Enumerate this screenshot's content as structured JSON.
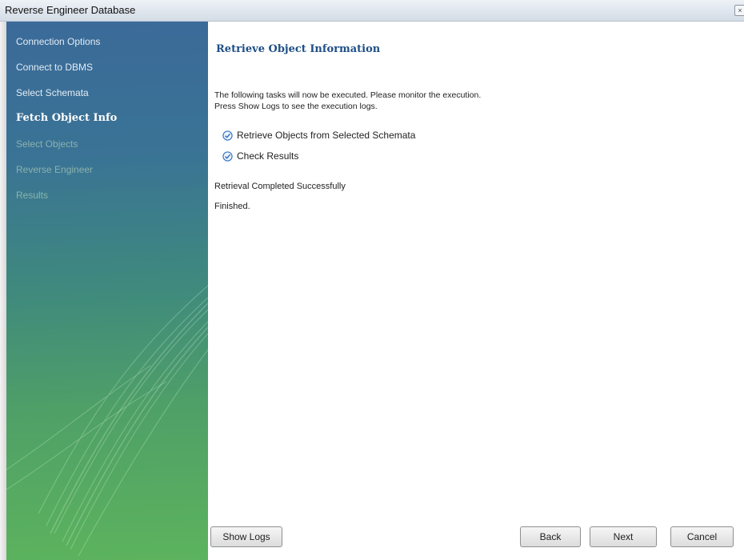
{
  "window": {
    "title": "Reverse Engineer Database"
  },
  "sidebar": {
    "steps": [
      {
        "label": "Connection Options",
        "state": "done"
      },
      {
        "label": "Connect to DBMS",
        "state": "done"
      },
      {
        "label": "Select Schemata",
        "state": "done"
      },
      {
        "label": "Fetch Object Info",
        "state": "current"
      },
      {
        "label": "Select Objects",
        "state": "pending"
      },
      {
        "label": "Reverse Engineer",
        "state": "pending"
      },
      {
        "label": "Results",
        "state": "pending"
      }
    ]
  },
  "main": {
    "heading": "Retrieve Object Information",
    "description": [
      "The following tasks will now be executed. Please monitor the execution.",
      "Press Show Logs to see the execution logs."
    ],
    "tasks": [
      {
        "label": "Retrieve Objects from Selected Schemata",
        "status": "done",
        "icon": "check-circle-icon"
      },
      {
        "label": "Check Results",
        "status": "done",
        "icon": "check-circle-icon"
      }
    ],
    "status_lines": [
      "Retrieval Completed Successfully",
      "Finished."
    ]
  },
  "buttons": {
    "show_logs": "Show Logs",
    "back": "Back",
    "next": "Next",
    "cancel": "Cancel"
  },
  "colors": {
    "heading": "#1f4f86",
    "check": "#3a78c4"
  }
}
